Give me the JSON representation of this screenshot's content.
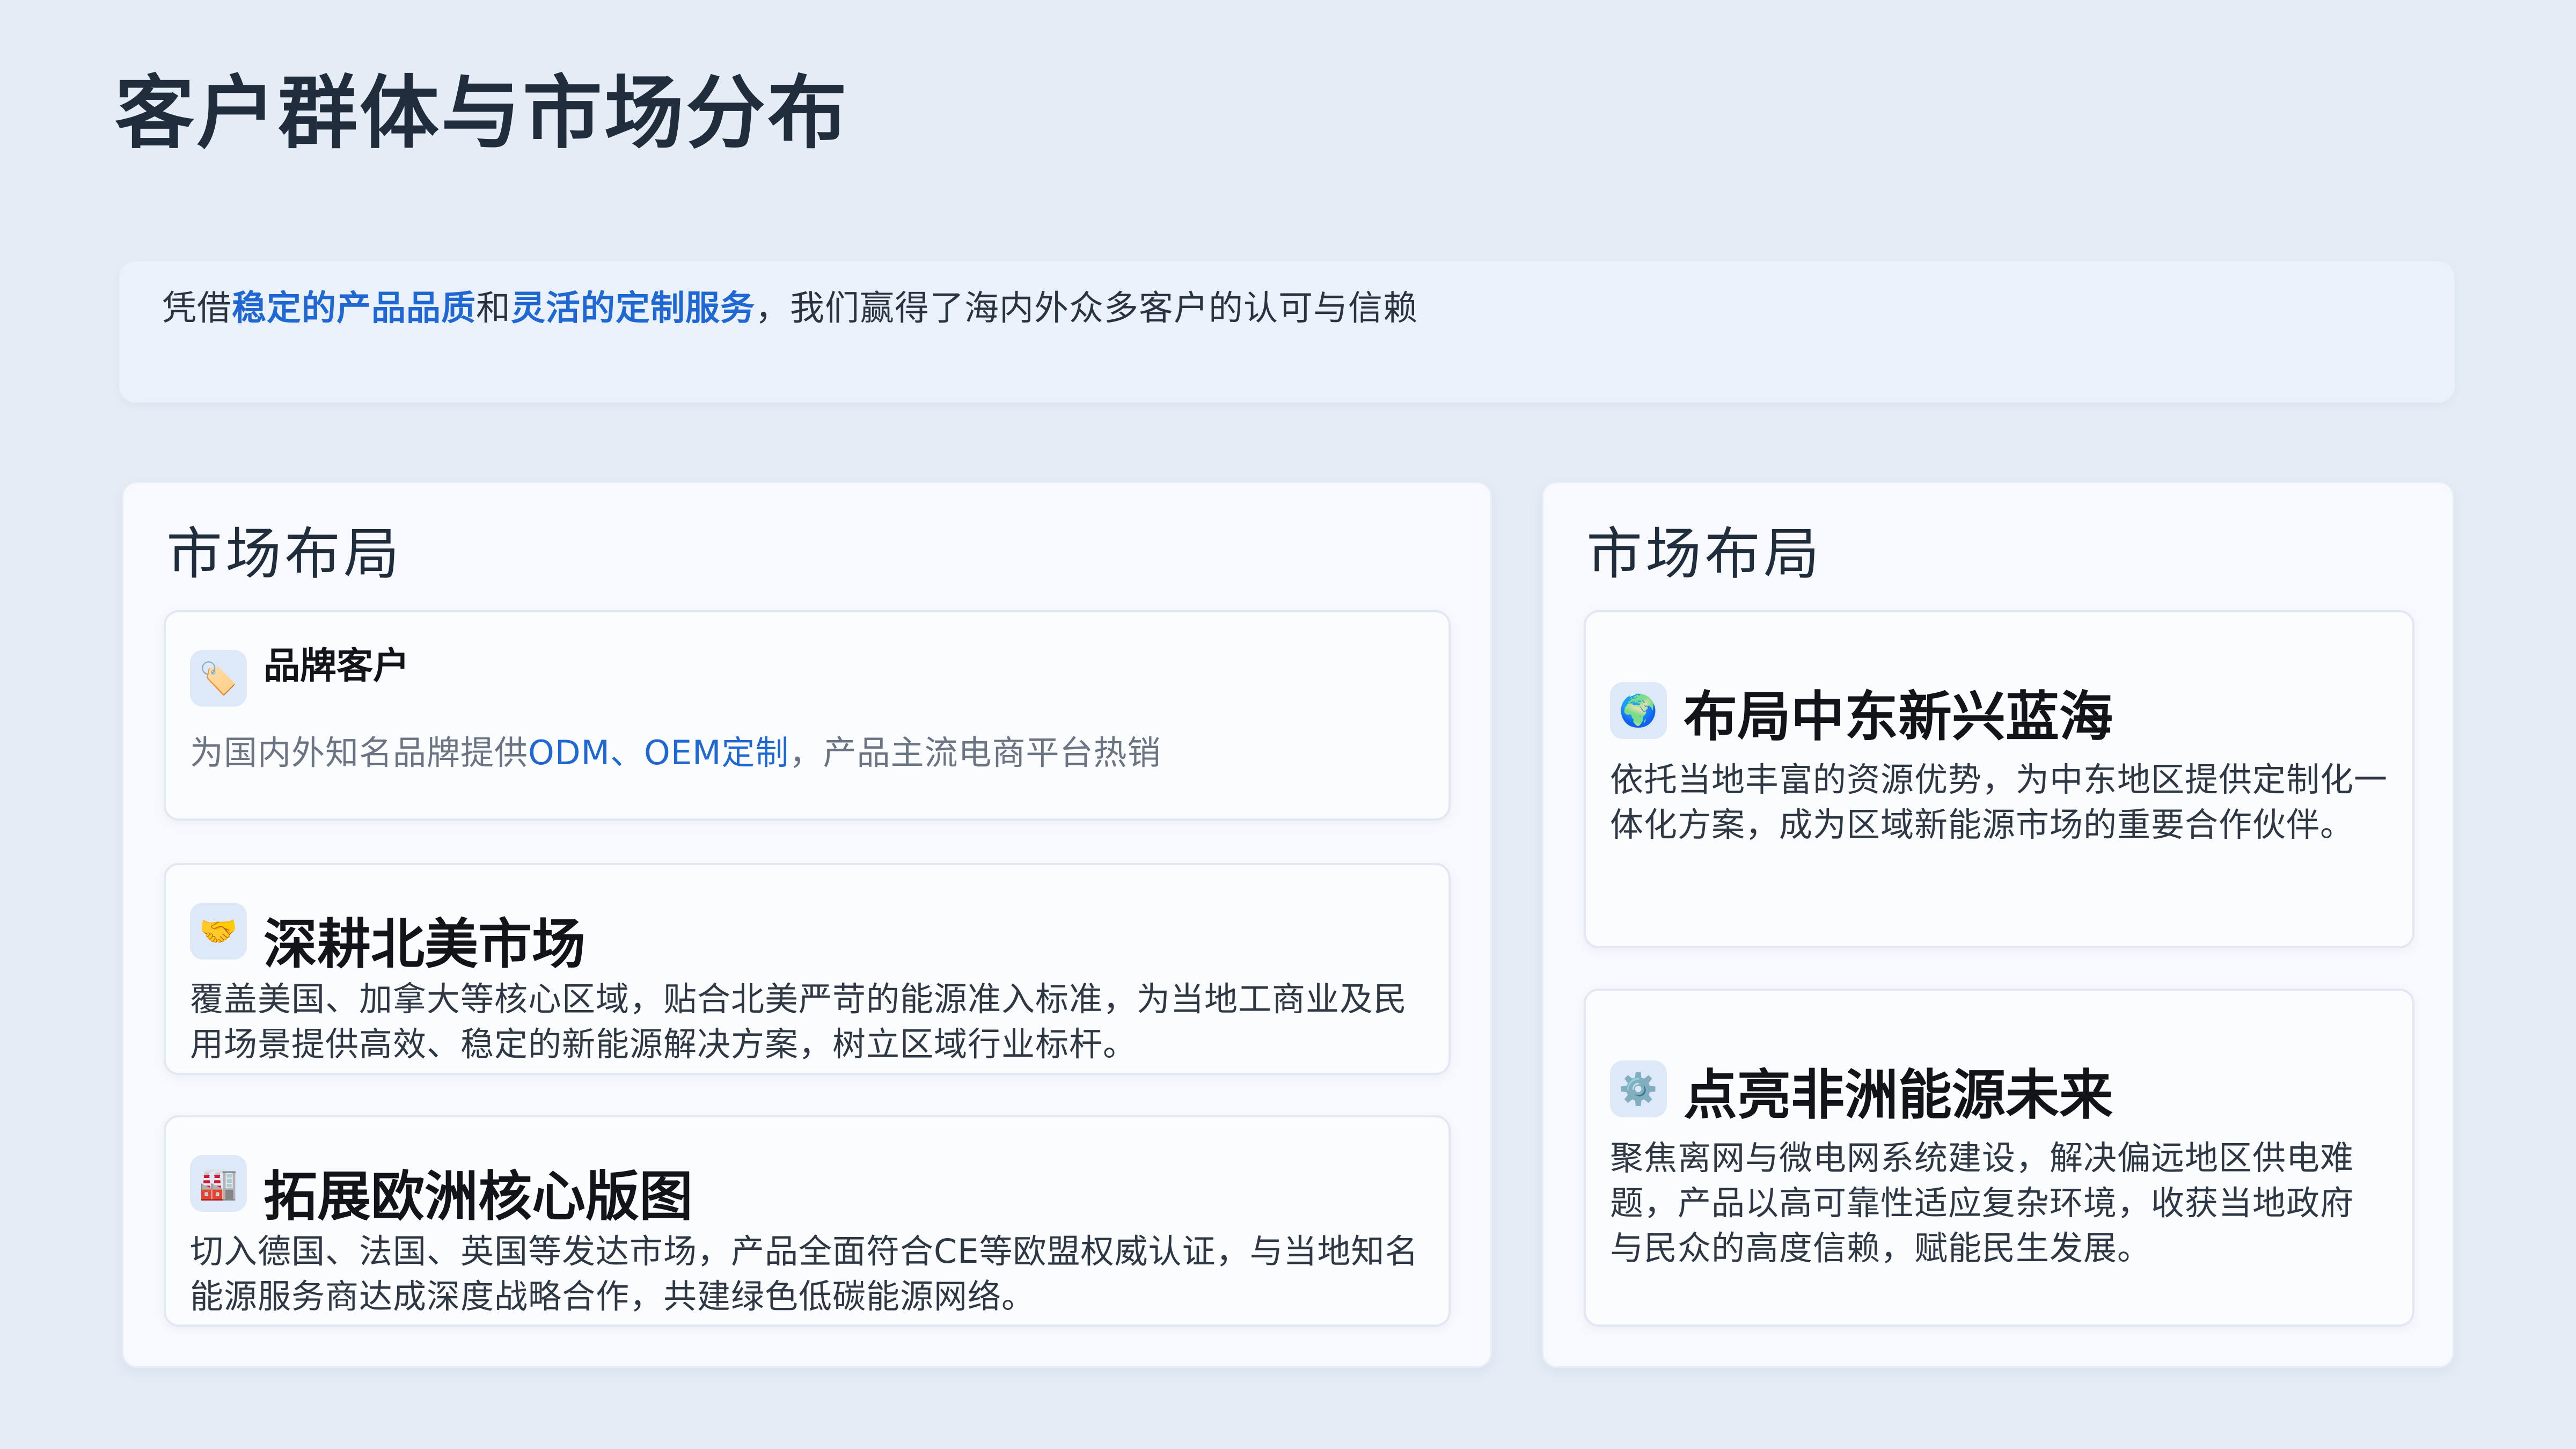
{
  "header": {
    "title": "客户群体与市场分布"
  },
  "intro": {
    "prefix": "凭借",
    "highlight1": "稳定的产品品质",
    "connector": "和",
    "highlight2": "灵活的定制服务",
    "suffix": "，我们赢得了海内外众多客户的认可与信赖"
  },
  "left_panel": {
    "title": "市场布局",
    "cards": [
      {
        "icon": "tag-icon",
        "icon_glyph": "🏷️",
        "heading": "品牌客户",
        "desc_prefix": "为国内外知名品牌提供",
        "desc_highlight": "ODM、OEM定制",
        "desc_suffix": "，产品主流电商平台热销"
      },
      {
        "icon": "handshake-icon",
        "icon_glyph": "🤝",
        "heading": "深耕北美市场",
        "desc": "覆盖美国、加拿大等核心区域，贴合北美严苛的能源准入标准，为当地工商业及民用场景提供高效、稳定的新能源解决方案，树立区域行业标杆。"
      },
      {
        "icon": "factory-icon",
        "icon_glyph": "🏭",
        "heading": "拓展欧洲核心版图",
        "desc": "切入德国、法国、英国等发达市场，产品全面符合CE等欧盟权威认证，与当地知名能源服务商达成深度战略合作，共建绿色低碳能源网络。"
      }
    ]
  },
  "right_panel": {
    "title": "市场布局",
    "cards": [
      {
        "icon": "globe-icon",
        "icon_glyph": "🌍",
        "heading": "布局中东新兴蓝海",
        "desc": "依托当地丰富的资源优势，为中东地区提供定制化一体化方案，成为区域新能源市场的重要合作伙伴。"
      },
      {
        "icon": "gear-icon",
        "icon_glyph": "⚙️",
        "heading": "点亮非洲能源未来",
        "desc": "聚焦离网与微电网系统建设，解决偏远地区供电难题，产品以高可靠性适应复杂环境，收获当地政府与民众的高度信赖，赋能民生发展。"
      }
    ]
  }
}
